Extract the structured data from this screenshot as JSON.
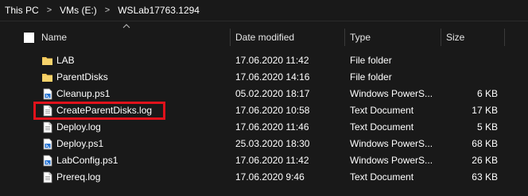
{
  "breadcrumb": [
    "This PC",
    "VMs (E:)",
    "WSLab17763.1294"
  ],
  "columns": {
    "name": "Name",
    "date": "Date modified",
    "type": "Type",
    "size": "Size"
  },
  "rows": [
    {
      "name": "LAB",
      "date": "17.06.2020 11:42",
      "type": "File folder",
      "size": "",
      "icon": "folder-icon"
    },
    {
      "name": "ParentDisks",
      "date": "17.06.2020 14:16",
      "type": "File folder",
      "size": "",
      "icon": "folder-icon"
    },
    {
      "name": "Cleanup.ps1",
      "date": "05.02.2020 18:17",
      "type": "Windows PowerS...",
      "size": "6 KB",
      "icon": "powershell-script-icon"
    },
    {
      "name": "CreateParentDisks.log",
      "date": "17.06.2020 10:58",
      "type": "Text Document",
      "size": "17 KB",
      "icon": "text-document-icon"
    },
    {
      "name": "Deploy.log",
      "date": "17.06.2020 11:46",
      "type": "Text Document",
      "size": "5 KB",
      "icon": "text-document-icon"
    },
    {
      "name": "Deploy.ps1",
      "date": "25.03.2020 18:30",
      "type": "Windows PowerS...",
      "size": "68 KB",
      "icon": "powershell-script-icon"
    },
    {
      "name": "LabConfig.ps1",
      "date": "17.06.2020 11:42",
      "type": "Windows PowerS...",
      "size": "26 KB",
      "icon": "powershell-script-icon"
    },
    {
      "name": "Prereq.log",
      "date": "17.06.2020 9:46",
      "type": "Text Document",
      "size": "63 KB",
      "icon": "text-document-icon"
    }
  ],
  "colors": {
    "background": "#191919",
    "highlight": "#e0121b",
    "folder": "#f4c85a"
  }
}
